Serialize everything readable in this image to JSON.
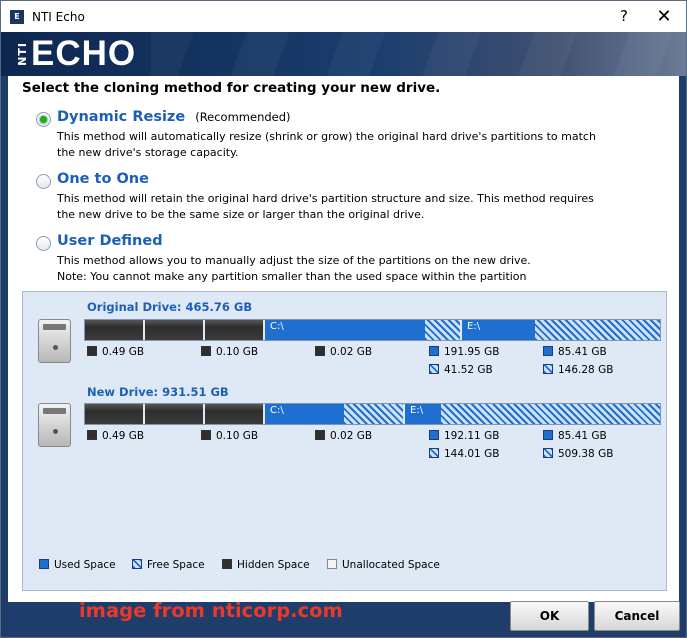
{
  "window": {
    "title": "NTI Echo",
    "help_label": "?",
    "close_label": "✕"
  },
  "banner": {
    "logo_prefix": "NTI",
    "logo_text": "ECHO"
  },
  "heading": "Select the cloning method for creating your new drive.",
  "options": [
    {
      "label": "Dynamic Resize",
      "note": "(Recommended)",
      "checked": true,
      "desc1": "This method will automatically resize (shrink or grow) the original hard drive's partitions to match",
      "desc2": "the new drive's storage capacity."
    },
    {
      "label": "One to One",
      "note": "",
      "checked": false,
      "desc1": "This method will retain the original hard drive's partition structure and size. This method requires",
      "desc2": "the new drive to be the same size or larger than the original drive."
    },
    {
      "label": "User Defined",
      "note": "",
      "checked": false,
      "desc1": "This method allows you to manually adjust the size of the partitions on the new drive.",
      "desc2": "Note: You cannot make any partition smaller than the used space within the partition"
    }
  ],
  "original_drive": {
    "title": "Original Drive: 465.76 GB",
    "partitions": [
      {
        "name": "",
        "type": "hidden",
        "used_fraction": 1.0
      },
      {
        "name": "",
        "type": "hidden",
        "used_fraction": 1.0
      },
      {
        "name": "",
        "type": "hidden",
        "used_fraction": 1.0
      },
      {
        "name": "C:\\",
        "type": "data",
        "used_fraction": 0.82
      },
      {
        "name": "E:\\",
        "type": "data",
        "used_fraction": 0.37
      }
    ],
    "stats": {
      "p1": "0.49 GB",
      "p2": "0.10 GB",
      "p3": "0.02 GB",
      "c_used": "191.95 GB",
      "c_free": "41.52 GB",
      "e_used": "85.41 GB",
      "e_free": "146.28 GB"
    }
  },
  "new_drive": {
    "title": "New Drive: 931.51 GB",
    "partitions": [
      {
        "name": "",
        "type": "hidden",
        "used_fraction": 1.0
      },
      {
        "name": "",
        "type": "hidden",
        "used_fraction": 1.0
      },
      {
        "name": "",
        "type": "hidden",
        "used_fraction": 1.0
      },
      {
        "name": "C:\\",
        "type": "data",
        "used_fraction": 0.57
      },
      {
        "name": "E:\\",
        "type": "data",
        "used_fraction": 0.14
      }
    ],
    "stats": {
      "p1": "0.49 GB",
      "p2": "0.10 GB",
      "p3": "0.02 GB",
      "c_used": "192.11 GB",
      "c_free": "144.01 GB",
      "e_used": "85.41 GB",
      "e_free": "509.38 GB"
    }
  },
  "legend": {
    "used": "Used Space",
    "free": "Free Space",
    "hidden": "Hidden Space",
    "unallocated": "Unallocated Space"
  },
  "watermark": "image from nticorp.com",
  "buttons": {
    "ok": "OK",
    "cancel": "Cancel"
  },
  "colors": {
    "accent": "#1c5fb8",
    "used": "#1f6fd0",
    "watermark": "#e83a2a"
  }
}
